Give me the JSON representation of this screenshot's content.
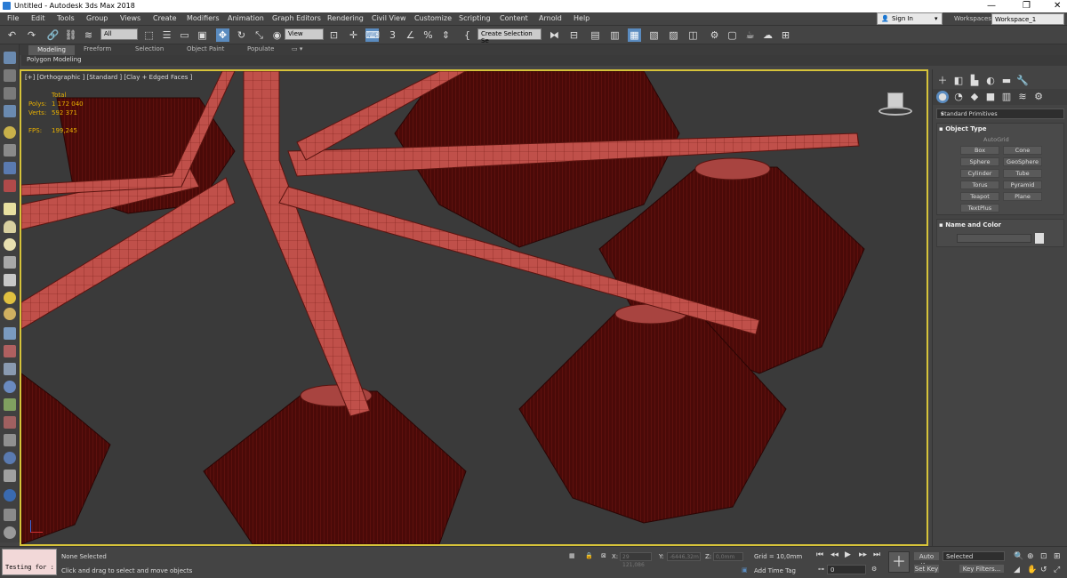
{
  "window": {
    "title": "Untitled - Autodesk 3ds Max 2018",
    "controls": [
      "—",
      "❐",
      "✕"
    ]
  },
  "menu": [
    "File",
    "Edit",
    "Tools",
    "Group",
    "Views",
    "Create",
    "Modifiers",
    "Animation",
    "Graph Editors",
    "Rendering",
    "Civil View",
    "Customize",
    "Scripting",
    "Content",
    "Arnold",
    "Help"
  ],
  "account": {
    "signin": "Sign In",
    "workspaces_label": "Workspaces:",
    "workspace": "Workspace_1"
  },
  "toolbar": {
    "filter": "All",
    "ref_coord": "View",
    "selection_set": "Create Selection Se"
  },
  "ribbon": {
    "tabs": [
      "Modeling",
      "Freeform",
      "Selection",
      "Object Paint",
      "Populate"
    ],
    "panel": "Polygon Modeling"
  },
  "viewport": {
    "label": "[+] [Orthographic ] [Standard ] [Clay + Edged Faces ]",
    "stats": {
      "total": "Total",
      "polys_label": "Polys:",
      "polys": "1 172 040",
      "verts_label": "Verts:",
      "verts": "592 371",
      "fps_label": "FPS:",
      "fps": "199,245"
    }
  },
  "command_panel": {
    "category": "Standard Primitives",
    "object_type_title": "Object Type",
    "autogrid": "AutoGrid",
    "buttons": [
      "Box",
      "Cone",
      "Sphere",
      "GeoSphere",
      "Cylinder",
      "Tube",
      "Torus",
      "Pyramid",
      "Teapot",
      "Plane",
      "TextPlus"
    ],
    "name_color_title": "Name and Color"
  },
  "status": {
    "maxscript": "Testing for :",
    "selection": "None Selected",
    "prompt": "Click and drag to select and move objects",
    "x_label": "X:",
    "x": "29 121,086",
    "y_label": "Y:",
    "y": "-6446,32m",
    "z_label": "Z:",
    "z": "0,0mm",
    "grid": "Grid = 10,0mm",
    "add_time_tag": "Add Time Tag",
    "frame": "0",
    "auto_key": "Auto Key",
    "set_key": "Set Key",
    "key_mode": "Selected",
    "key_filters": "Key Filters..."
  }
}
